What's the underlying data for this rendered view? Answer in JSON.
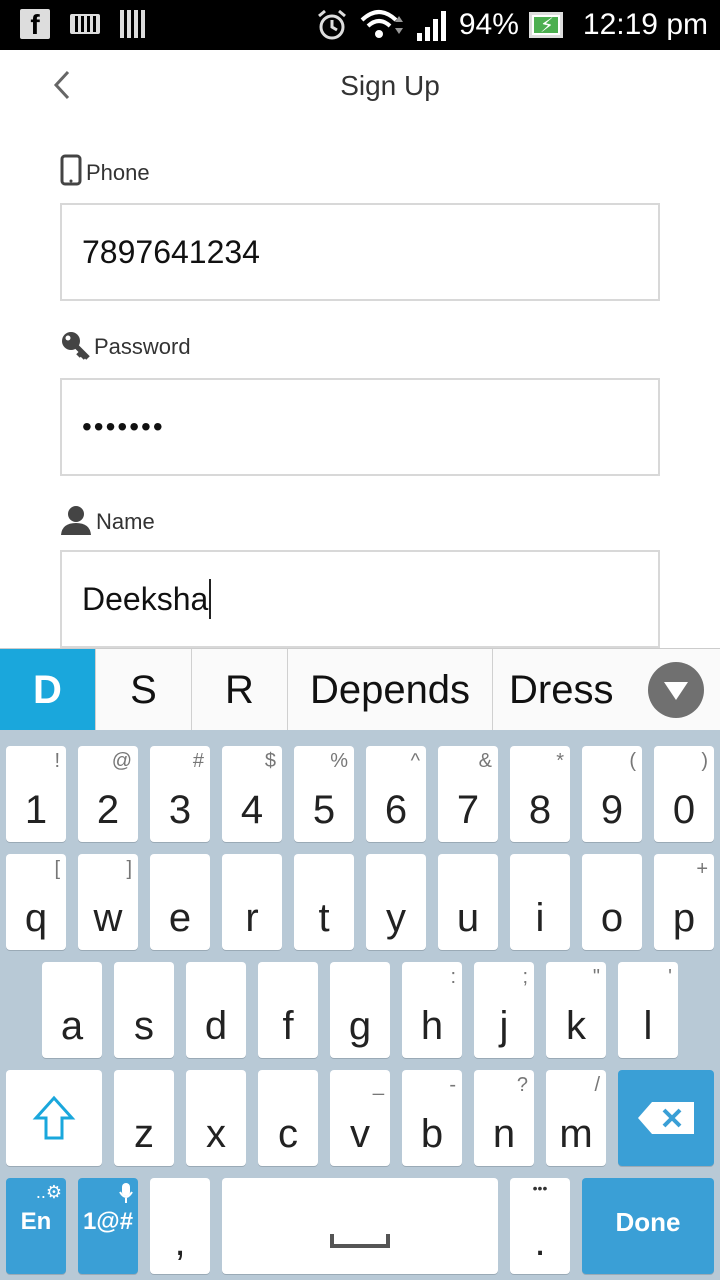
{
  "status_bar": {
    "battery_pct": "94%",
    "time": "12:19 pm",
    "icons": [
      "facebook-icon",
      "keyboard-icon",
      "barcode-icon",
      "alarm-icon",
      "wifi-icon",
      "signal-icon",
      "battery-charging-icon"
    ]
  },
  "header": {
    "title": "Sign Up"
  },
  "form": {
    "phone": {
      "label": "Phone",
      "value": "7897641234"
    },
    "password": {
      "label": "Password",
      "value": "•••••••"
    },
    "name": {
      "label": "Name",
      "value": "Deeksha"
    }
  },
  "suggestions": [
    "D",
    "S",
    "R",
    "Depends",
    "Dress"
  ],
  "keyboard": {
    "row_numbers": [
      {
        "main": "1",
        "alt": "!"
      },
      {
        "main": "2",
        "alt": "@"
      },
      {
        "main": "3",
        "alt": "#"
      },
      {
        "main": "4",
        "alt": "$"
      },
      {
        "main": "5",
        "alt": "%"
      },
      {
        "main": "6",
        "alt": "^"
      },
      {
        "main": "7",
        "alt": "&"
      },
      {
        "main": "8",
        "alt": "*"
      },
      {
        "main": "9",
        "alt": "("
      },
      {
        "main": "0",
        "alt": ")"
      }
    ],
    "row_q": [
      {
        "main": "q",
        "alt": "["
      },
      {
        "main": "w",
        "alt": "]"
      },
      {
        "main": "e",
        "alt": ""
      },
      {
        "main": "r",
        "alt": ""
      },
      {
        "main": "t",
        "alt": ""
      },
      {
        "main": "y",
        "alt": ""
      },
      {
        "main": "u",
        "alt": ""
      },
      {
        "main": "i",
        "alt": ""
      },
      {
        "main": "o",
        "alt": ""
      },
      {
        "main": "p",
        "alt": "+"
      }
    ],
    "row_a": [
      {
        "main": "a",
        "alt": ""
      },
      {
        "main": "s",
        "alt": ""
      },
      {
        "main": "d",
        "alt": ""
      },
      {
        "main": "f",
        "alt": ""
      },
      {
        "main": "g",
        "alt": ""
      },
      {
        "main": "h",
        "alt": ":"
      },
      {
        "main": "j",
        "alt": ";"
      },
      {
        "main": "k",
        "alt": "\""
      },
      {
        "main": "l",
        "alt": "'"
      }
    ],
    "row_z": [
      {
        "main": "z",
        "alt": ""
      },
      {
        "main": "x",
        "alt": ""
      },
      {
        "main": "c",
        "alt": ""
      },
      {
        "main": "v",
        "alt": "_"
      },
      {
        "main": "b",
        "alt": "-"
      },
      {
        "main": "n",
        "alt": "?"
      },
      {
        "main": "m",
        "alt": "/"
      }
    ],
    "lang_label": "En",
    "symbols_label": "1@#",
    "comma": ",",
    "period": ".",
    "period_alt": "•••",
    "done_label": "Done"
  }
}
